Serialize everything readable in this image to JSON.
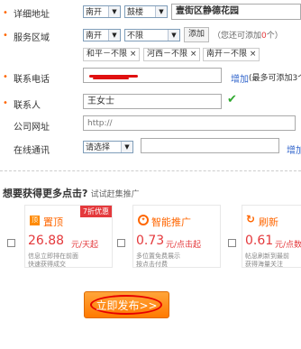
{
  "form": {
    "address": {
      "label": "详细地址",
      "district": "南开",
      "street": "鼓楼",
      "detail": "壹街区静德花园"
    },
    "service_area": {
      "label": "服务区域",
      "district": "南开",
      "scope": "不限",
      "add_button": "添加",
      "hint_prefix": "（您还可添加",
      "hint_count": "0",
      "hint_suffix": "个）",
      "tags": [
        "和平－不限",
        "河西－不限",
        "南开－不限"
      ],
      "remove_symbol": "×"
    },
    "phone": {
      "label": "联系电话",
      "add_link": "增加",
      "limit_hint": "(最多可添加3个"
    },
    "contact": {
      "label": "联系人",
      "value": "王女士",
      "valid_mark": "✔"
    },
    "website": {
      "label": "公司网址",
      "placeholder": "http://"
    },
    "im": {
      "label": "在线通讯",
      "select_value": "请选择",
      "add_link": "增加"
    }
  },
  "promo": {
    "heading": "想要获得更多点击?",
    "subheading": "试试赶集推广",
    "cards": [
      {
        "badge": "7折优惠",
        "icon_glyph": "顶",
        "title": "置顶",
        "price": "26.88",
        "unit": "元/天起",
        "desc1": "信息立即排在前面",
        "desc2": "快速获得成交"
      },
      {
        "icon_glyph": "✦",
        "title": "智能推广",
        "price": "0.73",
        "unit": "元/点击起",
        "desc1": "多位置免费展示",
        "desc2": "按点击付费"
      },
      {
        "icon_glyph": "↻",
        "title": "刷新",
        "price": "0.61",
        "unit": "元/点数",
        "desc1": "帖息刷新到最前",
        "desc2": "获得海量关注"
      }
    ]
  },
  "submit": {
    "label": "立即发布>>"
  },
  "colors": {
    "accent_orange": "#ff6600",
    "price_red": "#e4393c",
    "link_blue": "#3366cc",
    "check_green": "#2ea82e"
  }
}
